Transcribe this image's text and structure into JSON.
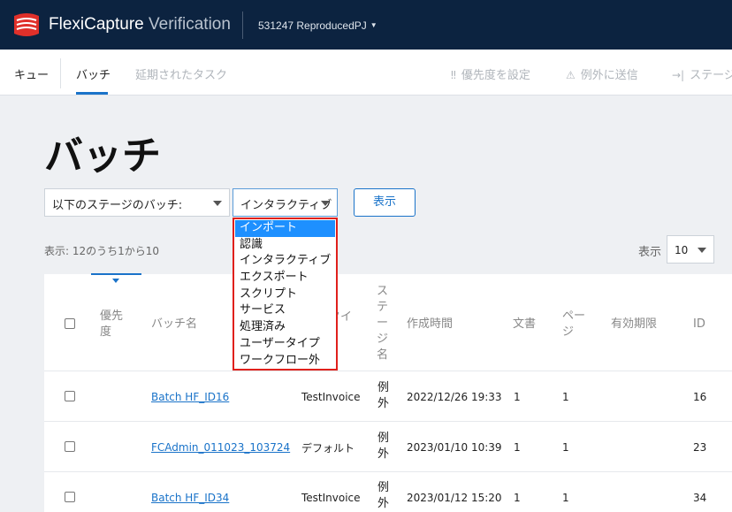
{
  "app": {
    "title_main": "FlexiCapture",
    "title_sub": "Verification",
    "project": "531247 ReproducedPJ"
  },
  "nav": {
    "queue": "キュー",
    "batch": "バッチ",
    "deferred": "延期されたタスク",
    "actions": [
      {
        "icon": "priority-icon",
        "glyph": "‼",
        "label": "優先度を設定"
      },
      {
        "icon": "send-exception-icon",
        "glyph": "⚠",
        "label": "例外に送信"
      },
      {
        "icon": "send-stage-icon",
        "glyph": "→|",
        "label": "ステージ"
      }
    ]
  },
  "page": {
    "title": "バッチ",
    "stage_filter": "以下のステージのバッチ:",
    "type_filter": "インタラクティブ",
    "show_button": "表示",
    "summary": "表示: 12のうち1から10",
    "show_label": "表示",
    "page_size": "10"
  },
  "dropdown": {
    "items": [
      "インポート",
      "認識",
      "インタラクティブ",
      "エクスポート",
      "スクリプト",
      "サービス",
      "処理済み",
      "ユーザータイプ",
      "ワークフロー外"
    ],
    "selected": "インポート"
  },
  "table": {
    "headers": {
      "priority": "優先度",
      "name": "バッチ名",
      "type": "タイ",
      "stage": "ステージ名",
      "created": "作成時間",
      "docs": "文書",
      "pages": "ページ",
      "expiry": "有効期限",
      "id": "ID"
    },
    "rows": [
      {
        "name": "Batch HF_ID16",
        "type": "TestInvoice",
        "stage": "例外",
        "created": "2022/12/26 19:33",
        "docs": "1",
        "pages": "1",
        "expiry": "",
        "id": "16"
      },
      {
        "name": "FCAdmin_011023_103724",
        "type": "デフォルト",
        "stage": "例外",
        "created": "2023/01/10 10:39",
        "docs": "1",
        "pages": "1",
        "expiry": "",
        "id": "23"
      },
      {
        "name": "Batch HF_ID34",
        "type": "TestInvoice",
        "stage": "例外",
        "created": "2023/01/12 15:20",
        "docs": "1",
        "pages": "1",
        "expiry": "",
        "id": "34"
      }
    ]
  },
  "colors": {
    "header_bg": "#0c2340",
    "accent": "#1a73c9",
    "dropdown_border": "#e0201c",
    "selected_bg": "#1e90ff"
  }
}
